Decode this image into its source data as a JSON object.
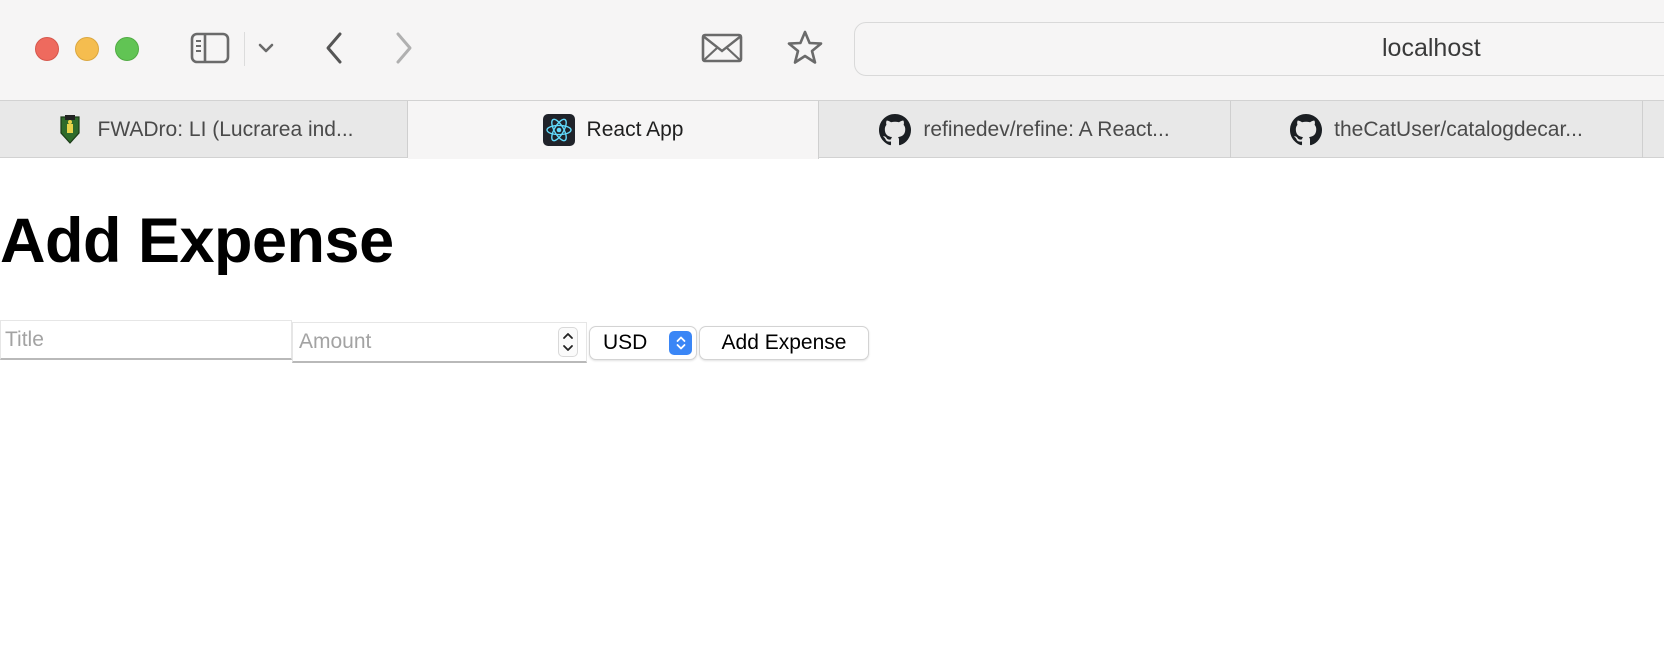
{
  "browser": {
    "url": "localhost",
    "tabs": [
      {
        "label": "FWADro: LI (Lucrarea ind...",
        "icon": "crest-icon"
      },
      {
        "label": "React App",
        "icon": "react-icon",
        "active": true
      },
      {
        "label": "refinedev/refine: A React...",
        "icon": "github-icon"
      },
      {
        "label": "theCatUser/catalogdecar...",
        "icon": "github-icon"
      }
    ],
    "colors": {
      "close": "#ee6a5e",
      "minimize": "#f5bd4f",
      "zoom": "#61c454"
    }
  },
  "page": {
    "title": "Add Expense",
    "form": {
      "title_placeholder": "Title",
      "amount_placeholder": "Amount",
      "currency_selected": "USD",
      "submit_label": "Add Expense"
    }
  }
}
